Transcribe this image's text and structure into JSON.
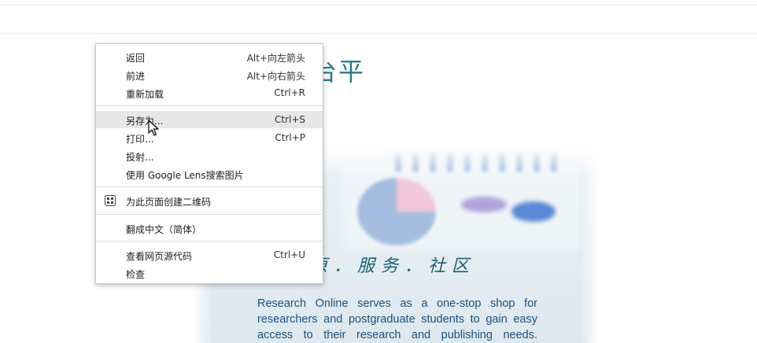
{
  "page": {
    "title_partial": "台平",
    "motto": "原．服务．社区",
    "intro_lines": [
      "Research Online serves as a one-stop shop for",
      "researchers and postgraduate students to gain easy",
      "access to their research and publishing needs."
    ]
  },
  "context_menu": {
    "items": [
      {
        "label": "返回",
        "shortcut": "Alt+向左箭头"
      },
      {
        "label": "前进",
        "shortcut": "Alt+向右箭头"
      },
      {
        "label": "重新加载",
        "shortcut": "Ctrl+R"
      },
      {
        "label": "另存为...",
        "shortcut": "Ctrl+S"
      },
      {
        "label": "打印...",
        "shortcut": "Ctrl+P"
      },
      {
        "label": "投射..."
      },
      {
        "label": "使用 Google Lens搜索图片"
      },
      {
        "label": "为此页面创建二维码",
        "icon": "qr-code-icon"
      },
      {
        "label": "翻成中文（简体）"
      },
      {
        "label": "查看网页源代码",
        "shortcut": "Ctrl+U"
      },
      {
        "label": "检查"
      }
    ],
    "hovered_index": 3
  },
  "colors": {
    "title_teal": "#2a7a86",
    "intro_blue": "#1e4f7d",
    "menu_hover": "#e7e7e7"
  }
}
